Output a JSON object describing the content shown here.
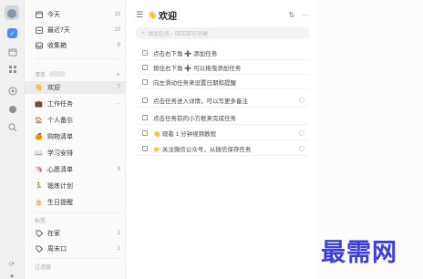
{
  "sidebar": {
    "smart_lists": [
      {
        "label": "今天",
        "count": "10",
        "icon": "calendar-today-icon"
      },
      {
        "label": "最近7天",
        "count": "10",
        "icon": "calendar-week-icon"
      },
      {
        "label": "收集箱",
        "count": "9",
        "icon": "inbox-icon"
      }
    ],
    "lists_section_title": "清单",
    "lists": [
      {
        "label": "欢迎",
        "count": "7",
        "emoji": "👋",
        "active": true
      },
      {
        "label": "工作任务",
        "count": "",
        "emoji": "💼"
      },
      {
        "label": "个人备忘",
        "count": "",
        "emoji": "🏠"
      },
      {
        "label": "购物清单",
        "count": "",
        "emoji": "🍊"
      },
      {
        "label": "学习安排",
        "count": "",
        "emoji": "📖"
      },
      {
        "label": "心愿清单",
        "count": "9",
        "emoji": "🦄"
      },
      {
        "label": "锻炼计划",
        "count": "",
        "emoji": "🏃"
      },
      {
        "label": "生日提醒",
        "count": "",
        "emoji": "🎂"
      }
    ],
    "tags_section_title": "标签",
    "tags": [
      {
        "label": "在家",
        "count": "1"
      },
      {
        "label": "周末口",
        "count": "1"
      }
    ],
    "filter_section_title": "过滤器"
  },
  "main": {
    "title": "欢迎",
    "add_placeholder": "添加任务，回车即可创建",
    "tasks": [
      "点击右下角 ➕ 添加任务",
      "按住右下角 ➕ 可以拖曳添加任务",
      "向左滑动任务来设置日期和提醒",
      "点击任务进入详情，可以写更多备注",
      "点击任务前的小方框来完成任务",
      "👋 观看 1 分钟视频教程",
      "👉 关注微信公众号，从微信保存任务"
    ]
  },
  "watermark": "最需网",
  "colors": {
    "accent": "#4a8cf7",
    "watermark": "#3b3fe0"
  }
}
